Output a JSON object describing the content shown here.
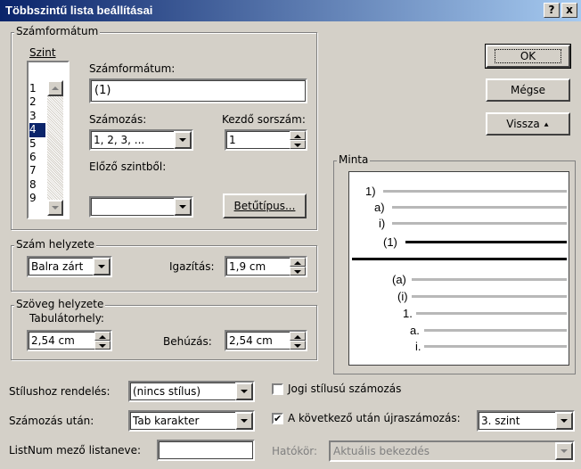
{
  "window": {
    "title": "Többszintű lista beállításai",
    "help_btn": "?",
    "close_btn": "x"
  },
  "number_format": {
    "group_label": "Számformátum",
    "level_label": "Szint",
    "levels": [
      "1",
      "2",
      "3",
      "4",
      "5",
      "6",
      "7",
      "8",
      "9"
    ],
    "selected_level": "4",
    "format_label": "Számformátum:",
    "format_value": "(1)",
    "numbering_label": "Számozás:",
    "numbering_value": "1, 2, 3, ...",
    "start_label": "Kezdő sorszám:",
    "start_value": "1",
    "prev_level_label": "Előző szintből:",
    "prev_level_value": "",
    "font_button": "Betűtípus..."
  },
  "number_position": {
    "group_label": "Szám helyzete",
    "align_value": "Balra zárt",
    "alignment_label": "Igazítás:",
    "alignment_value": "1,9 cm"
  },
  "text_position": {
    "group_label": "Szöveg helyzete",
    "tab_label": "Tabulátorhely:",
    "tab_value": "2,54 cm",
    "indent_label": "Behúzás:",
    "indent_value": "2,54 cm"
  },
  "buttons": {
    "ok": "OK",
    "cancel": "Mégse",
    "back": "Vissza",
    "back_arrow": "⯅"
  },
  "preview": {
    "label": "Minta",
    "items": [
      "1)",
      "a)",
      "i)",
      "(1)",
      "(a)",
      "(i)",
      "1.",
      "a.",
      "i."
    ]
  },
  "bottom": {
    "link_style_label": "Stílushoz rendelés:",
    "link_style_value": "(nincs stílus)",
    "follow_label": "Számozás után:",
    "follow_value": "Tab karakter",
    "listnum_label": "ListNum mező listaneve:",
    "listnum_value": "",
    "legal_label": "Jogi stílusú számozás",
    "legal_checked": false,
    "restart_label": "A következő után újraszámozás:",
    "restart_checked": true,
    "restart_value": "3. szint",
    "scope_label": "Hatókör:",
    "scope_value": "Aktuális bekezdés",
    "checkmark": "✔"
  }
}
